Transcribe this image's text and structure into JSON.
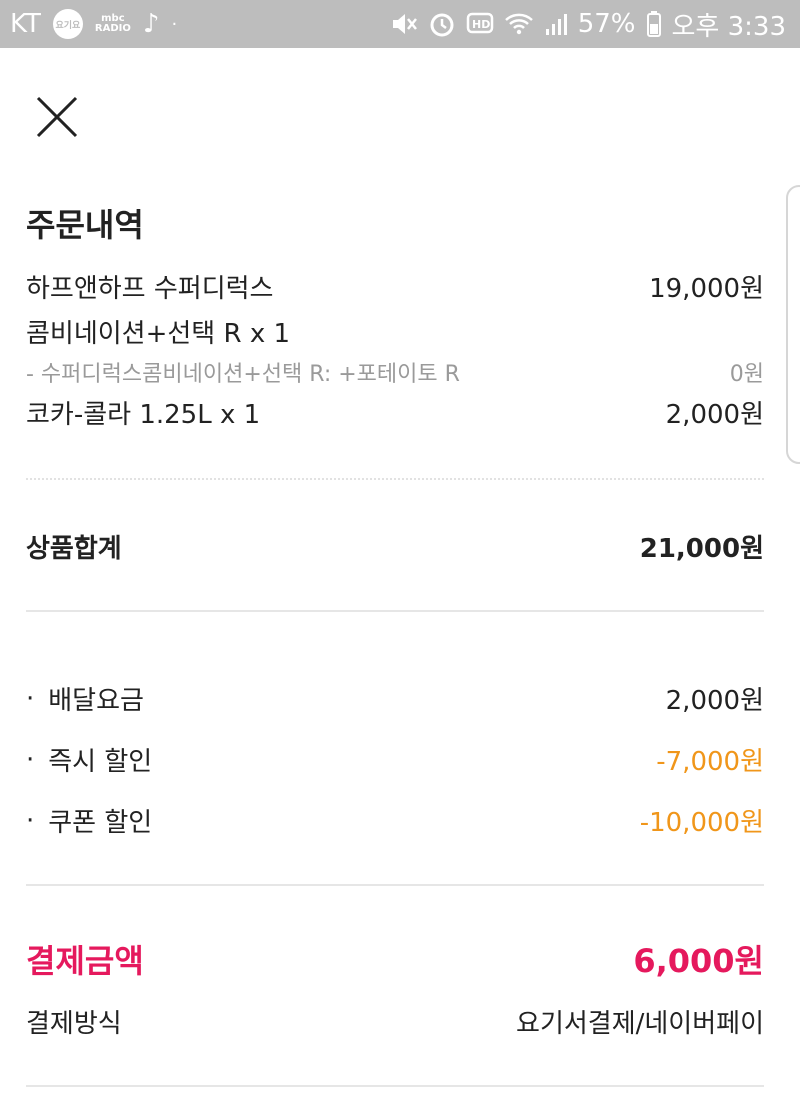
{
  "status_bar": {
    "carrier": "KT",
    "badge_text": "요기요",
    "mbc_line1": "mbc",
    "mbc_line2": "RADIO",
    "battery_percent": "57%",
    "time": "오후 3:33"
  },
  "section_title": "주문내역",
  "items": [
    {
      "name": "하프앤하프 수퍼디럭스",
      "price": "19,000원"
    },
    {
      "name": "콤비네이션+선택 R x 1",
      "price": ""
    },
    {
      "name": "- 수퍼디럭스콤비네이션+선택 R: +포테이토 R",
      "price": "0원"
    },
    {
      "name": "코카-콜라 1.25L x 1",
      "price": "2,000원"
    }
  ],
  "subtotal": {
    "label": "상품합계",
    "value": "21,000원"
  },
  "fees": [
    {
      "label": "배달요금",
      "value": "2,000원"
    },
    {
      "label": "즉시 할인",
      "value": "-7,000원"
    },
    {
      "label": "쿠폰 할인",
      "value": "-10,000원"
    }
  ],
  "total": {
    "label": "결제금액",
    "value": "6,000원"
  },
  "payment_method": {
    "label": "결제방식",
    "value": "요기서결제/네이버페이"
  },
  "colors": {
    "accent_pink": "#e5195d",
    "discount_orange": "#f0961a",
    "status_bar": "#bdbdbd"
  }
}
